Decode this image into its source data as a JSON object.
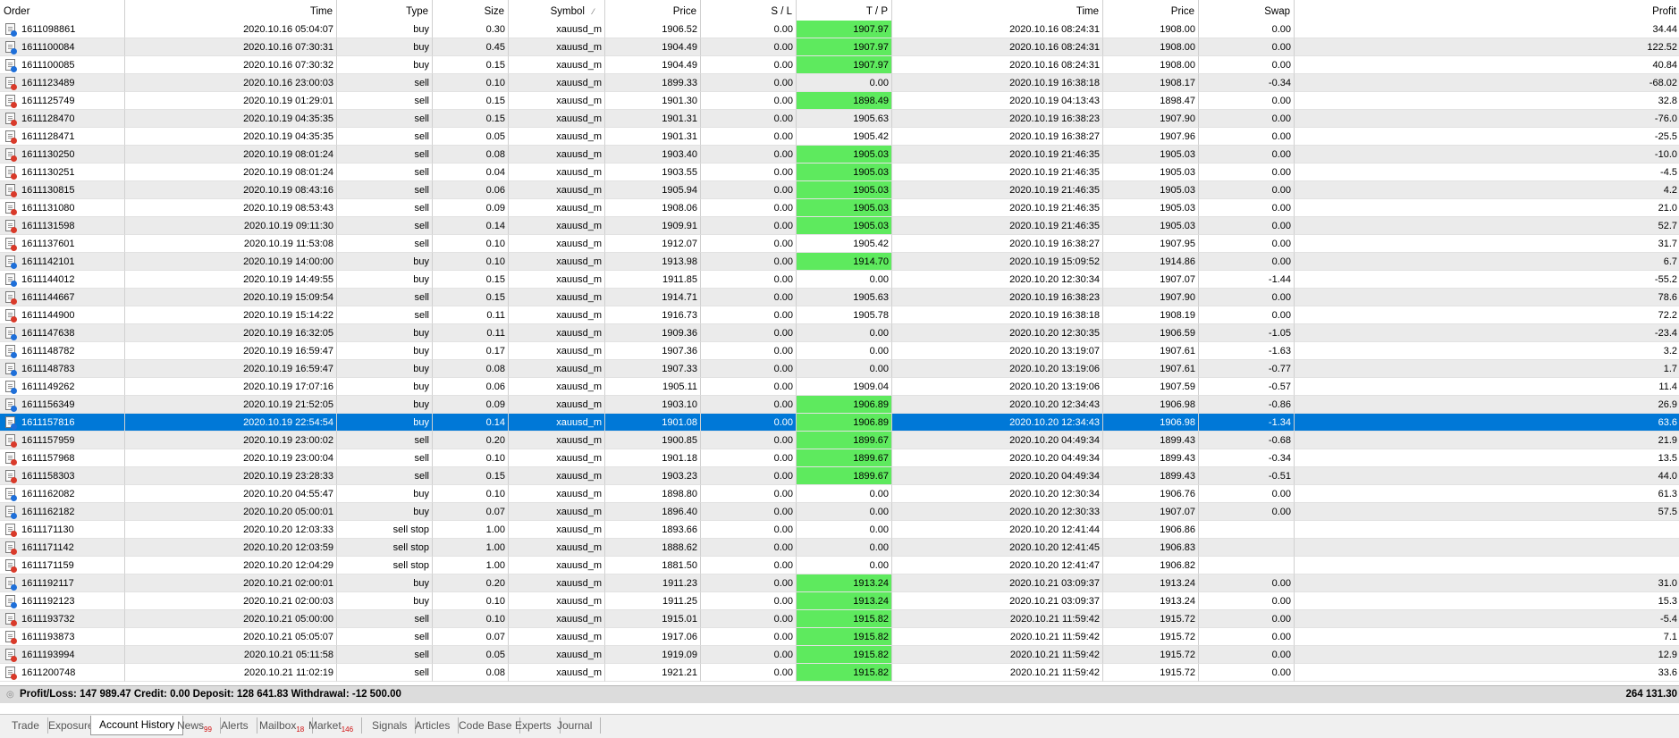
{
  "columns": [
    {
      "key": "order",
      "label": "Order"
    },
    {
      "key": "time",
      "label": "Time"
    },
    {
      "key": "type",
      "label": "Type"
    },
    {
      "key": "size",
      "label": "Size"
    },
    {
      "key": "symbol",
      "label": "Symbol"
    },
    {
      "key": "symbol_sort",
      "label": "⁄"
    },
    {
      "key": "price",
      "label": "Price"
    },
    {
      "key": "sl",
      "label": "S / L"
    },
    {
      "key": "tp",
      "label": "T / P"
    },
    {
      "key": "close_time",
      "label": "Time"
    },
    {
      "key": "close_price",
      "label": "Price"
    },
    {
      "key": "swap",
      "label": "Swap"
    },
    {
      "key": "profit",
      "label": "Profit"
    }
  ],
  "rows": [
    {
      "order": "1611098861",
      "time": "2020.10.16 05:04:07",
      "type": "buy",
      "size": "0.30",
      "symbol": "xauusd_m",
      "price": "1906.52",
      "sl": "0.00",
      "tp": "1907.97",
      "tp_hit": true,
      "close_time": "2020.10.16 08:24:31",
      "close_price": "1908.00",
      "swap": "0.00",
      "profit": "34.44"
    },
    {
      "order": "1611100084",
      "time": "2020.10.16 07:30:31",
      "type": "buy",
      "size": "0.45",
      "symbol": "xauusd_m",
      "price": "1904.49",
      "sl": "0.00",
      "tp": "1907.97",
      "tp_hit": true,
      "close_time": "2020.10.16 08:24:31",
      "close_price": "1908.00",
      "swap": "0.00",
      "profit": "122.52"
    },
    {
      "order": "1611100085",
      "time": "2020.10.16 07:30:32",
      "type": "buy",
      "size": "0.15",
      "symbol": "xauusd_m",
      "price": "1904.49",
      "sl": "0.00",
      "tp": "1907.97",
      "tp_hit": true,
      "close_time": "2020.10.16 08:24:31",
      "close_price": "1908.00",
      "swap": "0.00",
      "profit": "40.84"
    },
    {
      "order": "1611123489",
      "time": "2020.10.16 23:00:03",
      "type": "sell",
      "size": "0.10",
      "symbol": "xauusd_m",
      "price": "1899.33",
      "sl": "0.00",
      "tp": "0.00",
      "tp_hit": false,
      "close_time": "2020.10.19 16:38:18",
      "close_price": "1908.17",
      "swap": "-0.34",
      "profit": "-68.02"
    },
    {
      "order": "1611125749",
      "time": "2020.10.19 01:29:01",
      "type": "sell",
      "size": "0.15",
      "symbol": "xauusd_m",
      "price": "1901.30",
      "sl": "0.00",
      "tp": "1898.49",
      "tp_hit": true,
      "close_time": "2020.10.19 04:13:43",
      "close_price": "1898.47",
      "swap": "0.00",
      "profit": "32.8"
    },
    {
      "order": "1611128470",
      "time": "2020.10.19 04:35:35",
      "type": "sell",
      "size": "0.15",
      "symbol": "xauusd_m",
      "price": "1901.31",
      "sl": "0.00",
      "tp": "1905.63",
      "tp_hit": false,
      "close_time": "2020.10.19 16:38:23",
      "close_price": "1907.90",
      "swap": "0.00",
      "profit": "-76.0"
    },
    {
      "order": "1611128471",
      "time": "2020.10.19 04:35:35",
      "type": "sell",
      "size": "0.05",
      "symbol": "xauusd_m",
      "price": "1901.31",
      "sl": "0.00",
      "tp": "1905.42",
      "tp_hit": false,
      "close_time": "2020.10.19 16:38:27",
      "close_price": "1907.96",
      "swap": "0.00",
      "profit": "-25.5"
    },
    {
      "order": "1611130250",
      "time": "2020.10.19 08:01:24",
      "type": "sell",
      "size": "0.08",
      "symbol": "xauusd_m",
      "price": "1903.40",
      "sl": "0.00",
      "tp": "1905.03",
      "tp_hit": true,
      "close_time": "2020.10.19 21:46:35",
      "close_price": "1905.03",
      "swap": "0.00",
      "profit": "-10.0"
    },
    {
      "order": "1611130251",
      "time": "2020.10.19 08:01:24",
      "type": "sell",
      "size": "0.04",
      "symbol": "xauusd_m",
      "price": "1903.55",
      "sl": "0.00",
      "tp": "1905.03",
      "tp_hit": true,
      "close_time": "2020.10.19 21:46:35",
      "close_price": "1905.03",
      "swap": "0.00",
      "profit": "-4.5"
    },
    {
      "order": "1611130815",
      "time": "2020.10.19 08:43:16",
      "type": "sell",
      "size": "0.06",
      "symbol": "xauusd_m",
      "price": "1905.94",
      "sl": "0.00",
      "tp": "1905.03",
      "tp_hit": true,
      "close_time": "2020.10.19 21:46:35",
      "close_price": "1905.03",
      "swap": "0.00",
      "profit": "4.2"
    },
    {
      "order": "1611131080",
      "time": "2020.10.19 08:53:43",
      "type": "sell",
      "size": "0.09",
      "symbol": "xauusd_m",
      "price": "1908.06",
      "sl": "0.00",
      "tp": "1905.03",
      "tp_hit": true,
      "close_time": "2020.10.19 21:46:35",
      "close_price": "1905.03",
      "swap": "0.00",
      "profit": "21.0"
    },
    {
      "order": "1611131598",
      "time": "2020.10.19 09:11:30",
      "type": "sell",
      "size": "0.14",
      "symbol": "xauusd_m",
      "price": "1909.91",
      "sl": "0.00",
      "tp": "1905.03",
      "tp_hit": true,
      "close_time": "2020.10.19 21:46:35",
      "close_price": "1905.03",
      "swap": "0.00",
      "profit": "52.7"
    },
    {
      "order": "1611137601",
      "time": "2020.10.19 11:53:08",
      "type": "sell",
      "size": "0.10",
      "symbol": "xauusd_m",
      "price": "1912.07",
      "sl": "0.00",
      "tp": "1905.42",
      "tp_hit": false,
      "close_time": "2020.10.19 16:38:27",
      "close_price": "1907.95",
      "swap": "0.00",
      "profit": "31.7"
    },
    {
      "order": "1611142101",
      "time": "2020.10.19 14:00:00",
      "type": "buy",
      "size": "0.10",
      "symbol": "xauusd_m",
      "price": "1913.98",
      "sl": "0.00",
      "tp": "1914.70",
      "tp_hit": true,
      "close_time": "2020.10.19 15:09:52",
      "close_price": "1914.86",
      "swap": "0.00",
      "profit": "6.7"
    },
    {
      "order": "1611144012",
      "time": "2020.10.19 14:49:55",
      "type": "buy",
      "size": "0.15",
      "symbol": "xauusd_m",
      "price": "1911.85",
      "sl": "0.00",
      "tp": "0.00",
      "tp_hit": false,
      "close_time": "2020.10.20 12:30:34",
      "close_price": "1907.07",
      "swap": "-1.44",
      "profit": "-55.2"
    },
    {
      "order": "1611144667",
      "time": "2020.10.19 15:09:54",
      "type": "sell",
      "size": "0.15",
      "symbol": "xauusd_m",
      "price": "1914.71",
      "sl": "0.00",
      "tp": "1905.63",
      "tp_hit": false,
      "close_time": "2020.10.19 16:38:23",
      "close_price": "1907.90",
      "swap": "0.00",
      "profit": "78.6"
    },
    {
      "order": "1611144900",
      "time": "2020.10.19 15:14:22",
      "type": "sell",
      "size": "0.11",
      "symbol": "xauusd_m",
      "price": "1916.73",
      "sl": "0.00",
      "tp": "1905.78",
      "tp_hit": false,
      "close_time": "2020.10.19 16:38:18",
      "close_price": "1908.19",
      "swap": "0.00",
      "profit": "72.2"
    },
    {
      "order": "1611147638",
      "time": "2020.10.19 16:32:05",
      "type": "buy",
      "size": "0.11",
      "symbol": "xauusd_m",
      "price": "1909.36",
      "sl": "0.00",
      "tp": "0.00",
      "tp_hit": false,
      "close_time": "2020.10.20 12:30:35",
      "close_price": "1906.59",
      "swap": "-1.05",
      "profit": "-23.4"
    },
    {
      "order": "1611148782",
      "time": "2020.10.19 16:59:47",
      "type": "buy",
      "size": "0.17",
      "symbol": "xauusd_m",
      "price": "1907.36",
      "sl": "0.00",
      "tp": "0.00",
      "tp_hit": false,
      "close_time": "2020.10.20 13:19:07",
      "close_price": "1907.61",
      "swap": "-1.63",
      "profit": "3.2"
    },
    {
      "order": "1611148783",
      "time": "2020.10.19 16:59:47",
      "type": "buy",
      "size": "0.08",
      "symbol": "xauusd_m",
      "price": "1907.33",
      "sl": "0.00",
      "tp": "0.00",
      "tp_hit": false,
      "close_time": "2020.10.20 13:19:06",
      "close_price": "1907.61",
      "swap": "-0.77",
      "profit": "1.7"
    },
    {
      "order": "1611149262",
      "time": "2020.10.19 17:07:16",
      "type": "buy",
      "size": "0.06",
      "symbol": "xauusd_m",
      "price": "1905.11",
      "sl": "0.00",
      "tp": "1909.04",
      "tp_hit": false,
      "close_time": "2020.10.20 13:19:06",
      "close_price": "1907.59",
      "swap": "-0.57",
      "profit": "11.4"
    },
    {
      "order": "1611156349",
      "time": "2020.10.19 21:52:05",
      "type": "buy",
      "size": "0.09",
      "symbol": "xauusd_m",
      "price": "1903.10",
      "sl": "0.00",
      "tp": "1906.89",
      "tp_hit": true,
      "close_time": "2020.10.20 12:34:43",
      "close_price": "1906.98",
      "swap": "-0.86",
      "profit": "26.9"
    },
    {
      "order": "1611157816",
      "time": "2020.10.19 22:54:54",
      "type": "buy",
      "size": "0.14",
      "symbol": "xauusd_m",
      "price": "1901.08",
      "sl": "0.00",
      "tp": "1906.89",
      "tp_hit": true,
      "selected": true,
      "close_time": "2020.10.20 12:34:43",
      "close_price": "1906.98",
      "swap": "-1.34",
      "profit": "63.6"
    },
    {
      "order": "1611157959",
      "time": "2020.10.19 23:00:02",
      "type": "sell",
      "size": "0.20",
      "symbol": "xauusd_m",
      "price": "1900.85",
      "sl": "0.00",
      "tp": "1899.67",
      "tp_hit": true,
      "close_time": "2020.10.20 04:49:34",
      "close_price": "1899.43",
      "swap": "-0.68",
      "profit": "21.9"
    },
    {
      "order": "1611157968",
      "time": "2020.10.19 23:00:04",
      "type": "sell",
      "size": "0.10",
      "symbol": "xauusd_m",
      "price": "1901.18",
      "sl": "0.00",
      "tp": "1899.67",
      "tp_hit": true,
      "close_time": "2020.10.20 04:49:34",
      "close_price": "1899.43",
      "swap": "-0.34",
      "profit": "13.5"
    },
    {
      "order": "1611158303",
      "time": "2020.10.19 23:28:33",
      "type": "sell",
      "size": "0.15",
      "symbol": "xauusd_m",
      "price": "1903.23",
      "sl": "0.00",
      "tp": "1899.67",
      "tp_hit": true,
      "close_time": "2020.10.20 04:49:34",
      "close_price": "1899.43",
      "swap": "-0.51",
      "profit": "44.0"
    },
    {
      "order": "1611162082",
      "time": "2020.10.20 04:55:47",
      "type": "buy",
      "size": "0.10",
      "symbol": "xauusd_m",
      "price": "1898.80",
      "sl": "0.00",
      "tp": "0.00",
      "tp_hit": false,
      "close_time": "2020.10.20 12:30:34",
      "close_price": "1906.76",
      "swap": "0.00",
      "profit": "61.3"
    },
    {
      "order": "1611162182",
      "time": "2020.10.20 05:00:01",
      "type": "buy",
      "size": "0.07",
      "symbol": "xauusd_m",
      "price": "1896.40",
      "sl": "0.00",
      "tp": "0.00",
      "tp_hit": false,
      "close_time": "2020.10.20 12:30:33",
      "close_price": "1907.07",
      "swap": "0.00",
      "profit": "57.5"
    },
    {
      "order": "1611171130",
      "time": "2020.10.20 12:03:33",
      "type": "sell stop",
      "size": "1.00",
      "symbol": "xauusd_m",
      "price": "1893.66",
      "sl": "0.00",
      "tp": "0.00",
      "tp_hit": false,
      "close_time": "2020.10.20 12:41:44",
      "close_price": "1906.86",
      "swap": "",
      "profit": ""
    },
    {
      "order": "1611171142",
      "time": "2020.10.20 12:03:59",
      "type": "sell stop",
      "size": "1.00",
      "symbol": "xauusd_m",
      "price": "1888.62",
      "sl": "0.00",
      "tp": "0.00",
      "tp_hit": false,
      "close_time": "2020.10.20 12:41:45",
      "close_price": "1906.83",
      "swap": "",
      "profit": ""
    },
    {
      "order": "1611171159",
      "time": "2020.10.20 12:04:29",
      "type": "sell stop",
      "size": "1.00",
      "symbol": "xauusd_m",
      "price": "1881.50",
      "sl": "0.00",
      "tp": "0.00",
      "tp_hit": false,
      "close_time": "2020.10.20 12:41:47",
      "close_price": "1906.82",
      "swap": "",
      "profit": ""
    },
    {
      "order": "1611192117",
      "time": "2020.10.21 02:00:01",
      "type": "buy",
      "size": "0.20",
      "symbol": "xauusd_m",
      "price": "1911.23",
      "sl": "0.00",
      "tp": "1913.24",
      "tp_hit": true,
      "close_time": "2020.10.21 03:09:37",
      "close_price": "1913.24",
      "swap": "0.00",
      "profit": "31.0"
    },
    {
      "order": "1611192123",
      "time": "2020.10.21 02:00:03",
      "type": "buy",
      "size": "0.10",
      "symbol": "xauusd_m",
      "price": "1911.25",
      "sl": "0.00",
      "tp": "1913.24",
      "tp_hit": true,
      "close_time": "2020.10.21 03:09:37",
      "close_price": "1913.24",
      "swap": "0.00",
      "profit": "15.3"
    },
    {
      "order": "1611193732",
      "time": "2020.10.21 05:00:00",
      "type": "sell",
      "size": "0.10",
      "symbol": "xauusd_m",
      "price": "1915.01",
      "sl": "0.00",
      "tp": "1915.82",
      "tp_hit": true,
      "close_time": "2020.10.21 11:59:42",
      "close_price": "1915.72",
      "swap": "0.00",
      "profit": "-5.4"
    },
    {
      "order": "1611193873",
      "time": "2020.10.21 05:05:07",
      "type": "sell",
      "size": "0.07",
      "symbol": "xauusd_m",
      "price": "1917.06",
      "sl": "0.00",
      "tp": "1915.82",
      "tp_hit": true,
      "close_time": "2020.10.21 11:59:42",
      "close_price": "1915.72",
      "swap": "0.00",
      "profit": "7.1"
    },
    {
      "order": "1611193994",
      "time": "2020.10.21 05:11:58",
      "type": "sell",
      "size": "0.05",
      "symbol": "xauusd_m",
      "price": "1919.09",
      "sl": "0.00",
      "tp": "1915.82",
      "tp_hit": true,
      "close_time": "2020.10.21 11:59:42",
      "close_price": "1915.72",
      "swap": "0.00",
      "profit": "12.9"
    },
    {
      "order": "1611200748",
      "time": "2020.10.21 11:02:19",
      "type": "sell",
      "size": "0.08",
      "symbol": "xauusd_m",
      "price": "1921.21",
      "sl": "0.00",
      "tp": "1915.82",
      "tp_hit": true,
      "close_time": "2020.10.21 11:59:42",
      "close_price": "1915.72",
      "swap": "0.00",
      "profit": "33.6"
    }
  ],
  "summary": {
    "text": "Profit/Loss: 147 989.47  Credit: 0.00  Deposit: 128 641.83  Withdrawal: -12 500.00",
    "total": "264 131.30"
  },
  "tabs": [
    {
      "label": "Trade",
      "badge": ""
    },
    {
      "label": "Exposure",
      "badge": ""
    },
    {
      "label": "Account History",
      "badge": "",
      "active": true
    },
    {
      "label": "News",
      "badge": "99"
    },
    {
      "label": "Alerts",
      "badge": ""
    },
    {
      "label": "Mailbox",
      "badge": "18"
    },
    {
      "label": "Market",
      "badge": "146"
    },
    {
      "label": "Signals",
      "badge": ""
    },
    {
      "label": "Articles",
      "badge": ""
    },
    {
      "label": "Code Base",
      "badge": ""
    },
    {
      "label": "Experts",
      "badge": ""
    },
    {
      "label": "Journal",
      "badge": ""
    }
  ],
  "colors": {
    "selection": "#0078d7",
    "tp_highlight": "#5eea5e",
    "stripe": "#ebebeb",
    "badge": "#d01010"
  },
  "icons": {
    "buy": "order-buy-icon",
    "sell": "order-sell-icon",
    "summary": "balance-icon"
  }
}
